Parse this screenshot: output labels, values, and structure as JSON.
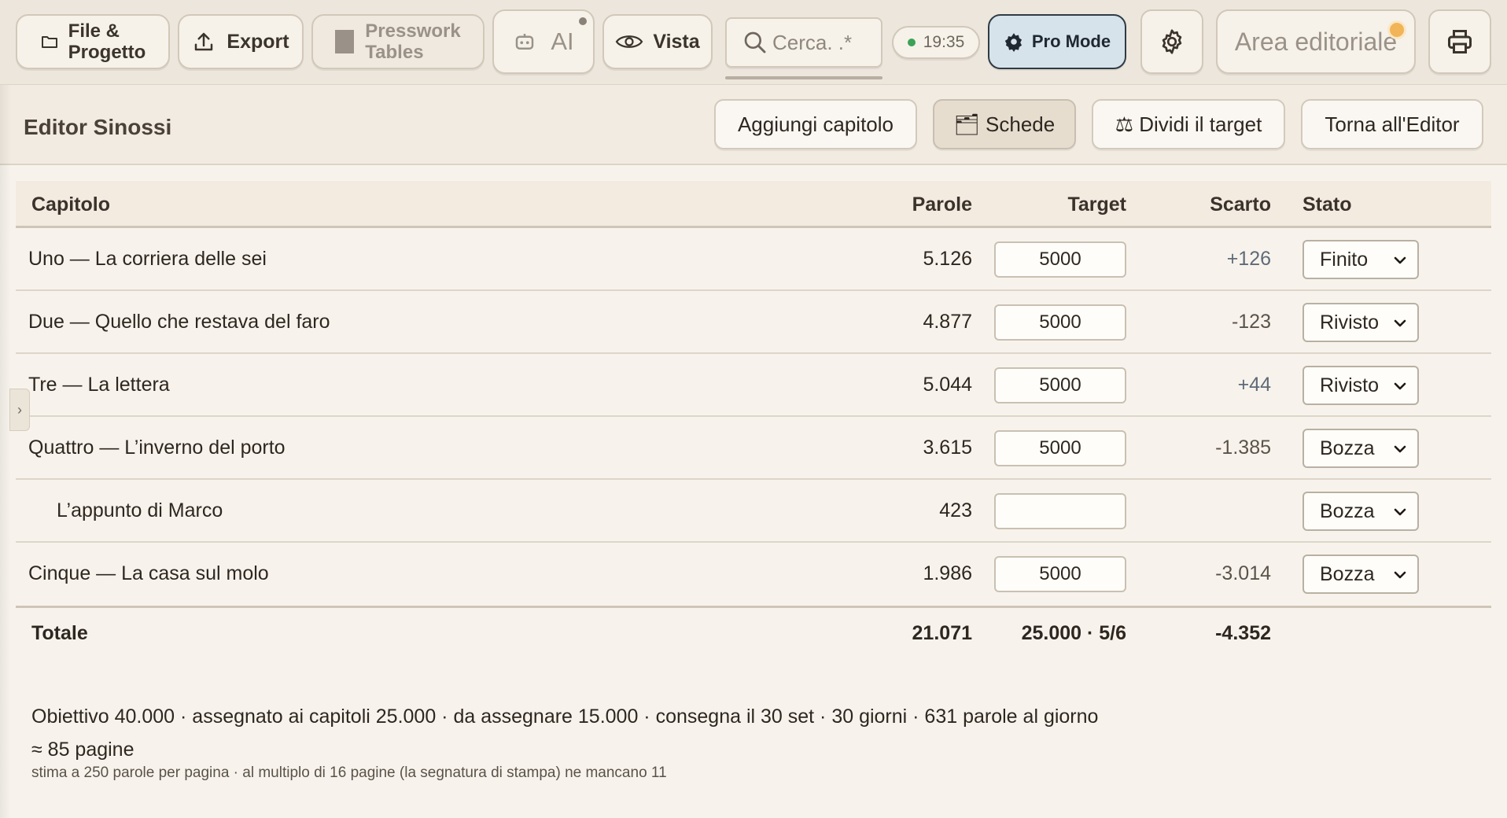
{
  "toolbar": {
    "file_label_1": "File &",
    "file_label_2": "Progetto",
    "export_label": "Export",
    "tables_label_1": "Presswork",
    "tables_label_2": "Tables",
    "ai_label": "AI",
    "view_label": "Vista",
    "search_placeholder": "Cerca. .*",
    "clock": "19:35",
    "pro_label": "Pro Mode",
    "area_label": "Area editoriale"
  },
  "header": {
    "title": "Editor Sinossi",
    "add_chapter": "Aggiungi capitolo",
    "cards": "🗂 Schede",
    "split_target": "⚖ Dividi il target",
    "back": "Torna all'Editor"
  },
  "table": {
    "headers": {
      "chapter": "Capitolo",
      "words": "Parole",
      "target": "Target",
      "diff": "Scarto",
      "state": "Stato"
    },
    "rows": [
      {
        "name": "Uno — La corriera delle sei",
        "words": "5.126",
        "target": "5000",
        "diff": "+126",
        "state": "Finito"
      },
      {
        "name": "Due — Quello che restava del faro",
        "words": "4.877",
        "target": "5000",
        "diff": "-123",
        "state": "Rivisto"
      },
      {
        "name": "Tre — La lettera",
        "words": "5.044",
        "target": "5000",
        "diff": "+44",
        "state": "Rivisto"
      },
      {
        "name": "Quattro — L’inverno del porto",
        "words": "3.615",
        "target": "5000",
        "diff": "-1.385",
        "state": "Bozza"
      },
      {
        "name": "L’appunto di Marco",
        "words": "423",
        "target": "",
        "diff": "",
        "state": "Bozza"
      },
      {
        "name": "Cinque — La casa sul molo",
        "words": "1.986",
        "target": "5000",
        "diff": "-3.014",
        "state": "Bozza"
      }
    ],
    "totals": {
      "label": "Totale",
      "words": "21.071",
      "target": "25.000 · 5/6",
      "diff": "-4.352"
    }
  },
  "summary": {
    "line": "Obiettivo 40.000 · assegnato ai capitoli 25.000 · da assegnare 15.000 · consegna il 30 set · 30 giorni · 631 parole al giorno",
    "pages": "≈ 85 pagine",
    "note": "stima a 250 parole per pagina · al multiplo di 16 pagine (la segnatura di stampa) ne mancano 11"
  },
  "sidebar_toggle": "›"
}
